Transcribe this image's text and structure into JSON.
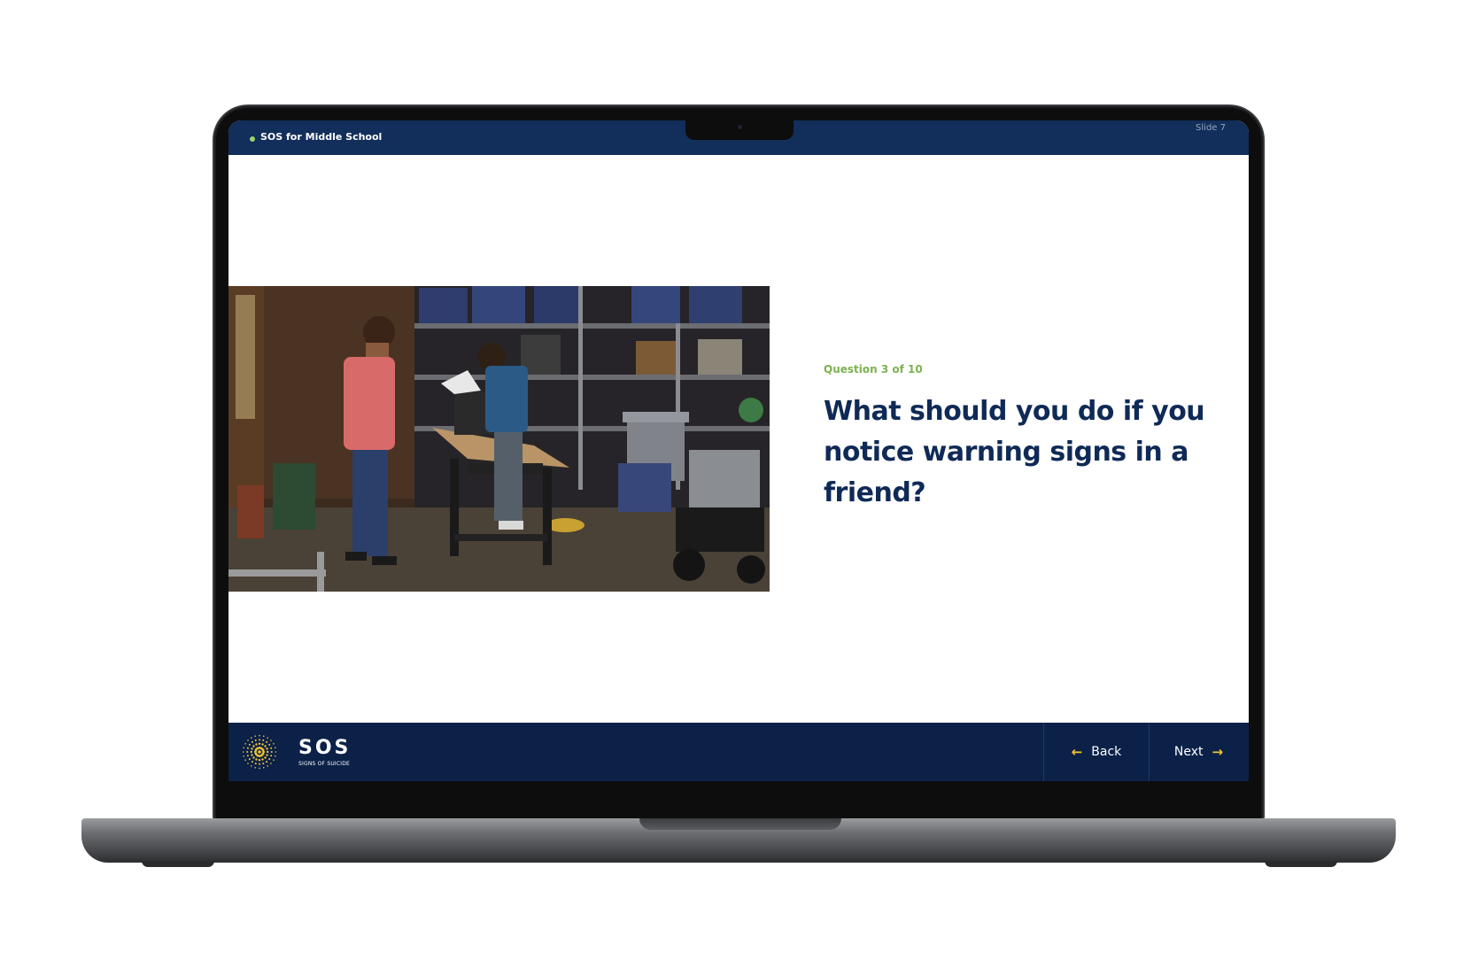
{
  "header": {
    "course_title": "SOS for Middle School",
    "slide_label": "Slide 7"
  },
  "slide": {
    "question_counter": "Question 3 of 10",
    "question_text": "What should you do if you notice warning signs in a friend?",
    "photo_icon": "photo-two-boys-in-garage"
  },
  "footer": {
    "logo_word": "SOS",
    "logo_subtitle": "SIGNS OF SUICIDE",
    "back_label": "Back",
    "next_label": "Next",
    "back_icon": "arrow-left-icon",
    "next_icon": "arrow-right-icon"
  },
  "colors": {
    "header_bg": "#122e5a",
    "footer_bg": "#0b2148",
    "question_text": "#0f2a56",
    "question_counter": "#7cb24f",
    "accent_arrow": "#f2c631",
    "status_dot": "#9bd36b"
  }
}
